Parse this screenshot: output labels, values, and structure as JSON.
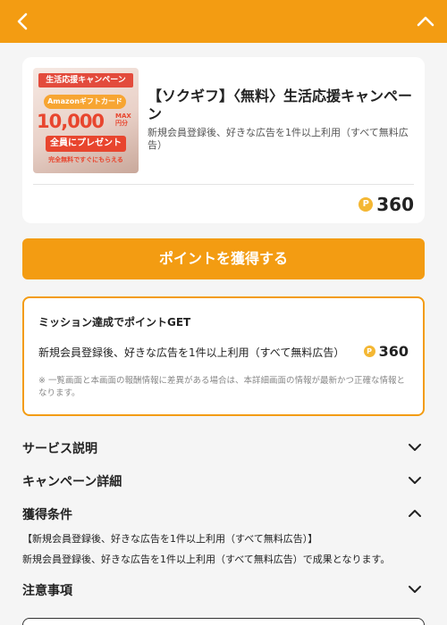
{
  "header": {
    "back_icon": "chevron-left-icon",
    "collapse_icon": "chevron-up-icon",
    "color": "#f39c12"
  },
  "campaign": {
    "title": "【ソクギフ】〈無料〉生活応援キャンペーン",
    "description": "新規会員登録後、好きな広告を1件以上利用（すべて無料広告）",
    "points": "360",
    "thumbnail": {
      "banner": "生活応援キャンペーン",
      "badge": "Amazonギフトカード",
      "amount": "10,000",
      "max": "MAX 円分",
      "present": "全員にプレゼント",
      "footer": "完全無料ですぐにもらえる"
    }
  },
  "cta": {
    "label": "ポイントを獲得する"
  },
  "mission": {
    "heading": "ミッション達成でポイントGET",
    "row_label": "新規会員登録後、好きな広告を1件以上利用（すべて無料広告）",
    "row_points": "360",
    "note": "※ 一覧画面と本画面の報酬情報に差異がある場合は、本詳細画面の情報が最新かつ正確な情報となります。"
  },
  "sections": {
    "service": "サービス説明",
    "campaign_detail": "キャンペーン詳細",
    "conditions": "獲得条件",
    "notes": "注意事項"
  },
  "conditions": {
    "line1": "【新規会員登録後、好きな広告を1件以上利用（すべて無料広告）】",
    "line2": "新規会員登録後、好きな広告を1件以上利用（すべて無料広告）で成果となります。"
  },
  "coin_symbol": "P"
}
